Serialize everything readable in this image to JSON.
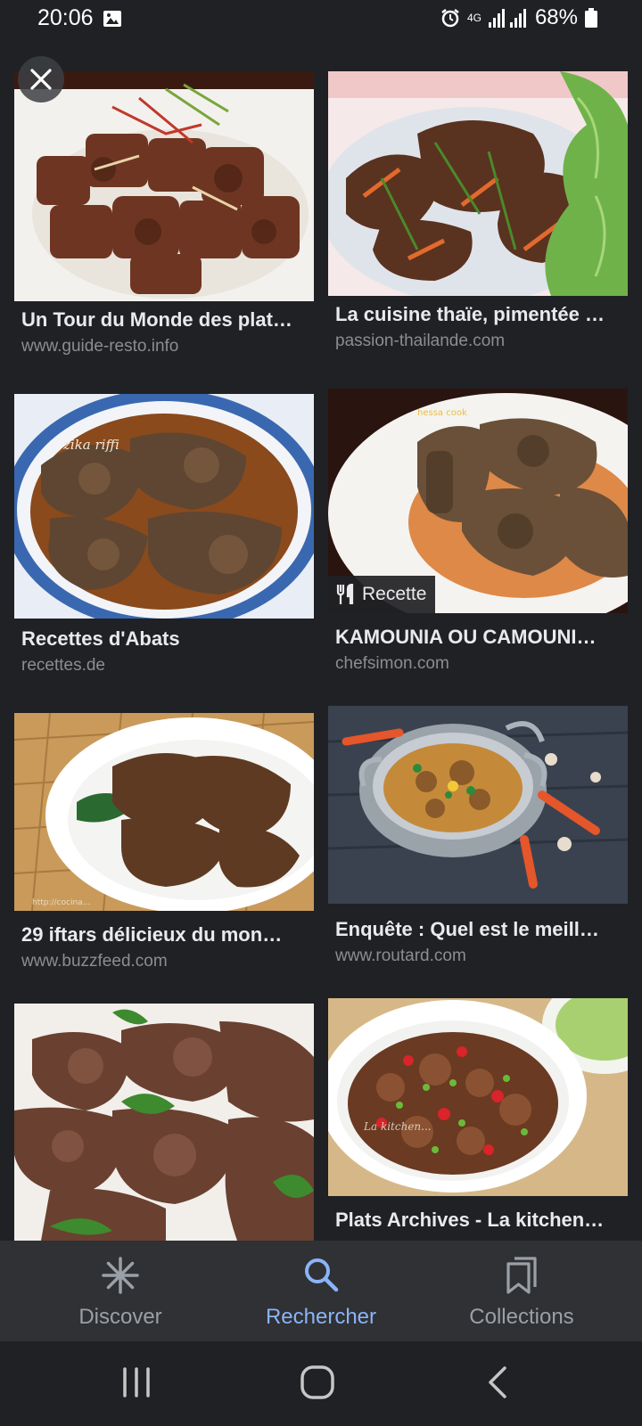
{
  "status_bar": {
    "time": "20:06",
    "network": "4G",
    "battery": "68%",
    "icons": [
      "gallery-icon",
      "alarm-icon",
      "signal-icon",
      "battery-icon"
    ]
  },
  "results": [
    {
      "title": "Un Tour du Monde des plat…",
      "source": "www.guide-resto.info"
    },
    {
      "title": "La cuisine thaïe, pimentée …",
      "source": "passion-thailande.com"
    },
    {
      "title": "Recettes d'Abats",
      "source": "recettes.de"
    },
    {
      "title": "KAMOUNIA OU CAMOUNI…",
      "source": "chefsimon.com",
      "badge": "Recette"
    },
    {
      "title": "29 iftars délicieux du mon…",
      "source": "www.buzzfeed.com"
    },
    {
      "title": "Enquête : Quel est le meill…",
      "source": "www.routard.com"
    },
    {
      "title": "",
      "source": ""
    },
    {
      "title": "Plats Archives - La kitchen…",
      "source": ""
    }
  ],
  "bottom_nav": {
    "items": [
      {
        "label": "Discover",
        "icon": "asterisk-icon"
      },
      {
        "label": "Rechercher",
        "icon": "search-icon",
        "active": true
      },
      {
        "label": "Collections",
        "icon": "bookmarks-icon"
      }
    ]
  },
  "colors": {
    "background": "#202124",
    "nav_bar": "#303134",
    "accent": "#8ab4f8",
    "secondary_text": "#8a8d91"
  }
}
